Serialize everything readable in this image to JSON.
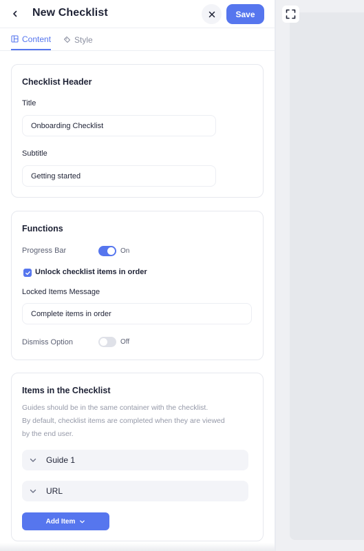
{
  "header": {
    "title": "New Checklist",
    "save_label": "Save",
    "back_icon": "chevron-left-icon",
    "close_icon": "close-icon"
  },
  "tabs": [
    {
      "label": "Content",
      "icon": "layout-icon",
      "active": true
    },
    {
      "label": "Style",
      "icon": "paint-bucket-icon",
      "active": false
    }
  ],
  "checklist_header": {
    "section_title": "Checklist Header",
    "title_label": "Title",
    "title_value": "Onboarding Checklist",
    "subtitle_label": "Subtitle",
    "subtitle_value": "Getting started"
  },
  "functions": {
    "section_title": "Functions",
    "progress_bar_label": "Progress Bar",
    "progress_bar_state": "On",
    "progress_bar_on": true,
    "unlock_label": "Unlock checklist items in order",
    "unlock_checked": true,
    "locked_message_label": "Locked Items Message",
    "locked_message_value": "Complete items in order",
    "dismiss_label": "Dismiss Option",
    "dismiss_state": "Off",
    "dismiss_on": false
  },
  "items": {
    "section_title": "Items in the Checklist",
    "description_line1": "Guides should be in the same container with the checklist.",
    "description_line2": "By default, checklist items are completed when they are viewed",
    "description_line3": "by the end user.",
    "list": [
      {
        "label": "Guide 1"
      },
      {
        "label": "URL"
      }
    ],
    "add_label": "Add Item"
  },
  "preview": {
    "fullscreen_icon": "fullscreen-icon"
  },
  "colors": {
    "accent": "#5676ee",
    "text": "#1e2235",
    "muted": "#9599a8"
  }
}
